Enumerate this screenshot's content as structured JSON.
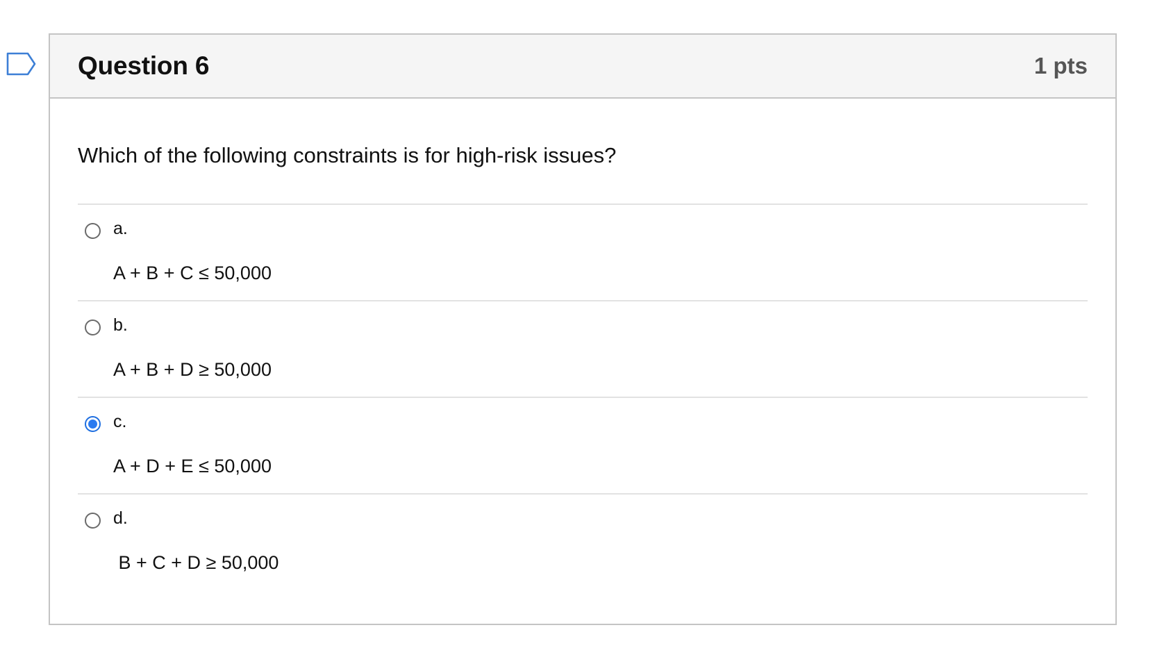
{
  "question": {
    "title": "Question 6",
    "points": "1 pts",
    "text": "Which of the following constraints is for high-risk issues?",
    "flag_icon": "flag-outline-icon",
    "accent_color": "#2b7bf0"
  },
  "answers": [
    {
      "letter": "a.",
      "expression": "A + B + C ≤ 50,000",
      "selected": false
    },
    {
      "letter": "b.",
      "expression": "A + B + D ≥ 50,000",
      "selected": false
    },
    {
      "letter": "c.",
      "expression": "A + D + E ≤ 50,000",
      "selected": true
    },
    {
      "letter": "d.",
      "expression": " B + C + D ≥ 50,000",
      "selected": false
    }
  ]
}
